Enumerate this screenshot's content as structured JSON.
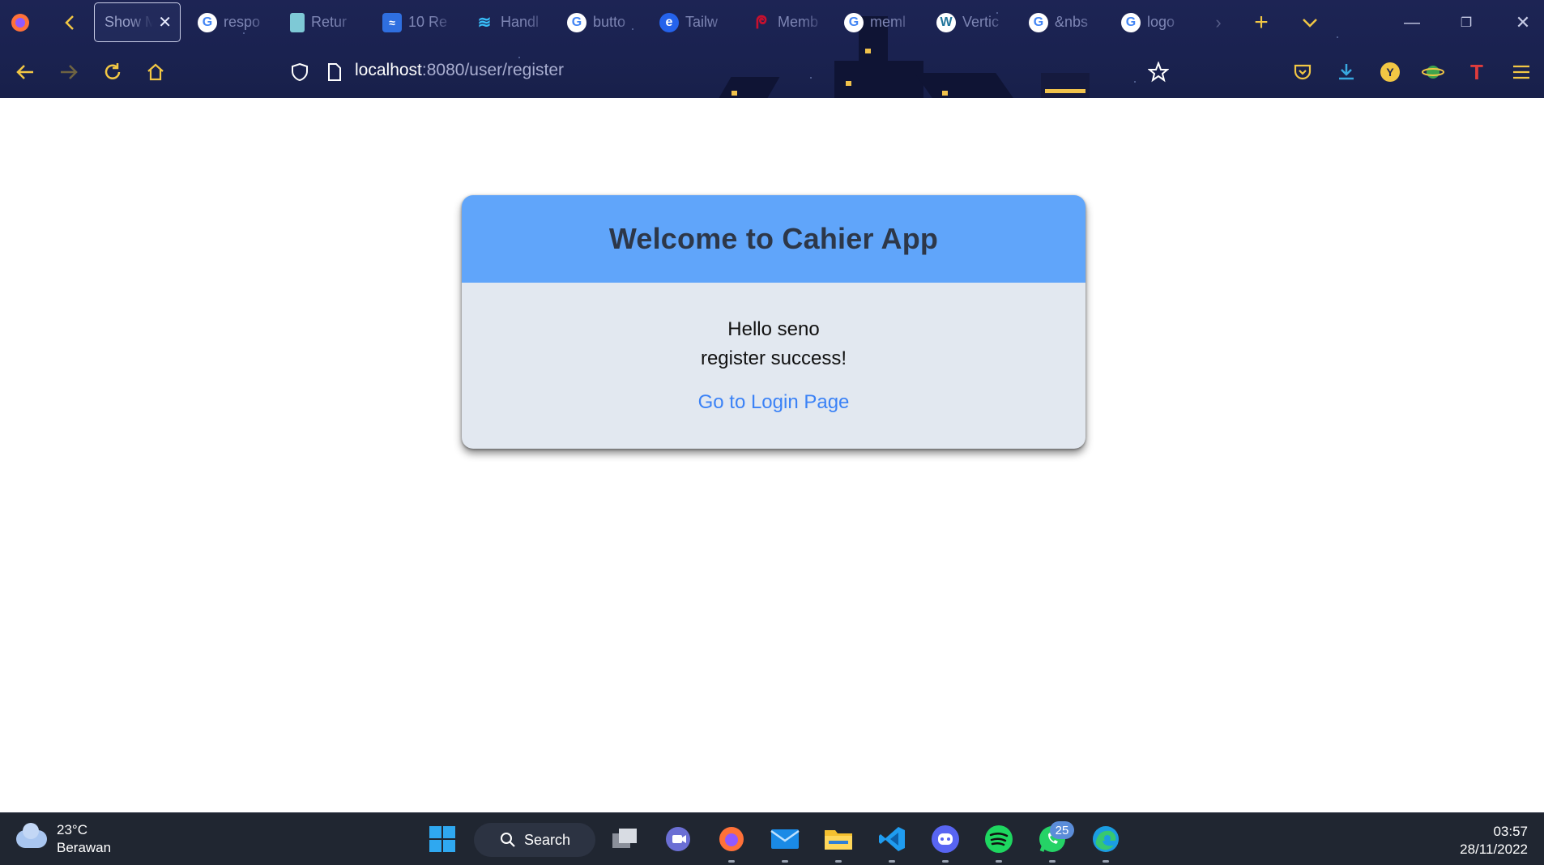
{
  "browser": {
    "url_host": "localhost",
    "url_rest": ":8080/user/register",
    "tabs": [
      {
        "title": "Show M",
        "icon": "page-icon",
        "active": true
      },
      {
        "title": "respo",
        "icon": "google-icon"
      },
      {
        "title": "Retur",
        "icon": "clipboard-icon"
      },
      {
        "title": "10 Re",
        "icon": "chart-icon"
      },
      {
        "title": "Handl",
        "icon": "tailwind-icon"
      },
      {
        "title": "butto",
        "icon": "google-icon"
      },
      {
        "title": "Tailw",
        "icon": "edge-like-icon"
      },
      {
        "title": "Memb",
        "icon": "debian-icon"
      },
      {
        "title": "meml",
        "icon": "google-icon"
      },
      {
        "title": "Vertic",
        "icon": "wordpress-icon"
      },
      {
        "title": "&nbs",
        "icon": "google-icon"
      },
      {
        "title": "logo",
        "icon": "google-icon"
      }
    ],
    "accent": "#f2c744"
  },
  "card": {
    "title": "Welcome to Cahier App",
    "greeting": "Hello seno",
    "status": "register success!",
    "link_label": "Go to Login Page",
    "header_color": "#60a5fa",
    "body_color": "#e2e8f0"
  },
  "taskbar": {
    "temperature": "23°C",
    "weather": "Berawan",
    "search_label": "Search",
    "whatsapp_badge": "25",
    "time": "03:57",
    "date": "28/11/2022"
  }
}
